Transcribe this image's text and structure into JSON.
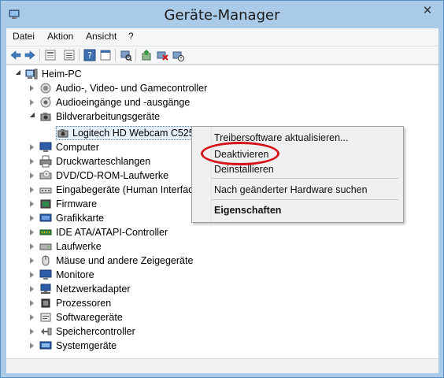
{
  "window": {
    "title": "Geräte-Manager",
    "close_glyph": "✕",
    "accent": "#aacbe8"
  },
  "menu": {
    "items": [
      "Datei",
      "Aktion",
      "Ansicht",
      "?"
    ]
  },
  "toolbar": {
    "icons": [
      "back-arrow-icon",
      "forward-arrow-icon",
      "properties-icon",
      "list-view-icon",
      "help-icon",
      "console-icon",
      "scan-hardware-icon",
      "update-driver-icon",
      "uninstall-icon",
      "disable-icon"
    ]
  },
  "tree": {
    "root": "Heim-PC",
    "categories": [
      "Audio-, Video- und Gamecontroller",
      "Audioeingänge und -ausgänge",
      "Bildverarbeitungsgeräte",
      "Computer",
      "Druckwarteschlangen",
      "DVD/CD-ROM-Laufwerke",
      "Eingabegeräte (Human Interface Devices)",
      "Firmware",
      "Grafikkarte",
      "IDE ATA/ATAPI-Controller",
      "Laufwerke",
      "Mäuse und andere Zeigegeräte",
      "Monitore",
      "Netzwerkadapter",
      "Prozessoren",
      "Softwaregeräte",
      "Speichercontroller",
      "Systemgeräte"
    ],
    "selected_device": "Logitech HD Webcam C525"
  },
  "context_menu": {
    "items": [
      "Treibersoftware aktualisieren...",
      "Deaktivieren",
      "Deinstallieren",
      "Nach geänderter Hardware suchen",
      "Eigenschaften"
    ],
    "highlight_color": "#d4141a"
  }
}
